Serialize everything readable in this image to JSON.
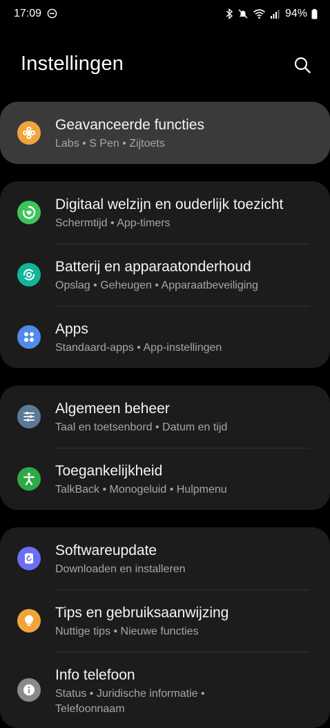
{
  "status_bar": {
    "time": "17:09",
    "battery": "94%",
    "icons": [
      "do-not-disturb-icon",
      "bluetooth-icon",
      "mute-icon",
      "wifi-icon",
      "signal-icon",
      "battery-icon"
    ]
  },
  "header": {
    "title": "Instellingen",
    "search_icon": "search-icon"
  },
  "cards": [
    {
      "items": [
        {
          "title": "Geavanceerde functies",
          "subtitle": "Labs  •  S Pen  •  Zijtoets",
          "icon": "advanced-features-icon",
          "color": "#f0a53c"
        }
      ]
    },
    {
      "items": [
        {
          "title": "Digitaal welzijn en ouderlijk toezicht",
          "subtitle": "Schermtijd  •  App-timers",
          "icon": "digital-wellbeing-icon",
          "color": "#3ec45a"
        },
        {
          "title": "Batterij en apparaatonderhoud",
          "subtitle": "Opslag  •  Geheugen  •  Apparaatbeveiliging",
          "icon": "device-care-icon",
          "color": "#12b49a"
        },
        {
          "title": "Apps",
          "subtitle": "Standaard-apps  •  App-instellingen",
          "icon": "apps-icon",
          "color": "#4f8be8"
        }
      ]
    },
    {
      "items": [
        {
          "title": "Algemeen beheer",
          "subtitle": "Taal en toetsenbord  •  Datum en tijd",
          "icon": "general-management-icon",
          "color": "#5c7a96"
        },
        {
          "title": "Toegankelijkheid",
          "subtitle": "TalkBack  •  Monogeluid  •  Hulpmenu",
          "icon": "accessibility-icon",
          "color": "#2fa845"
        }
      ]
    },
    {
      "items": [
        {
          "title": "Softwareupdate",
          "subtitle": "Downloaden en installeren",
          "icon": "software-update-icon",
          "color": "#6a6ef0"
        },
        {
          "title": "Tips en gebruiksaanwijzing",
          "subtitle": "Nuttige tips  •  Nieuwe functies",
          "icon": "tips-icon",
          "color": "#f0a53c"
        },
        {
          "title": "Info telefoon",
          "subtitle": "Status  •  Juridische informatie  •",
          "subtitle2": "Telefoonnaam",
          "icon": "about-phone-icon",
          "color": "#8a8a8a"
        }
      ]
    }
  ]
}
